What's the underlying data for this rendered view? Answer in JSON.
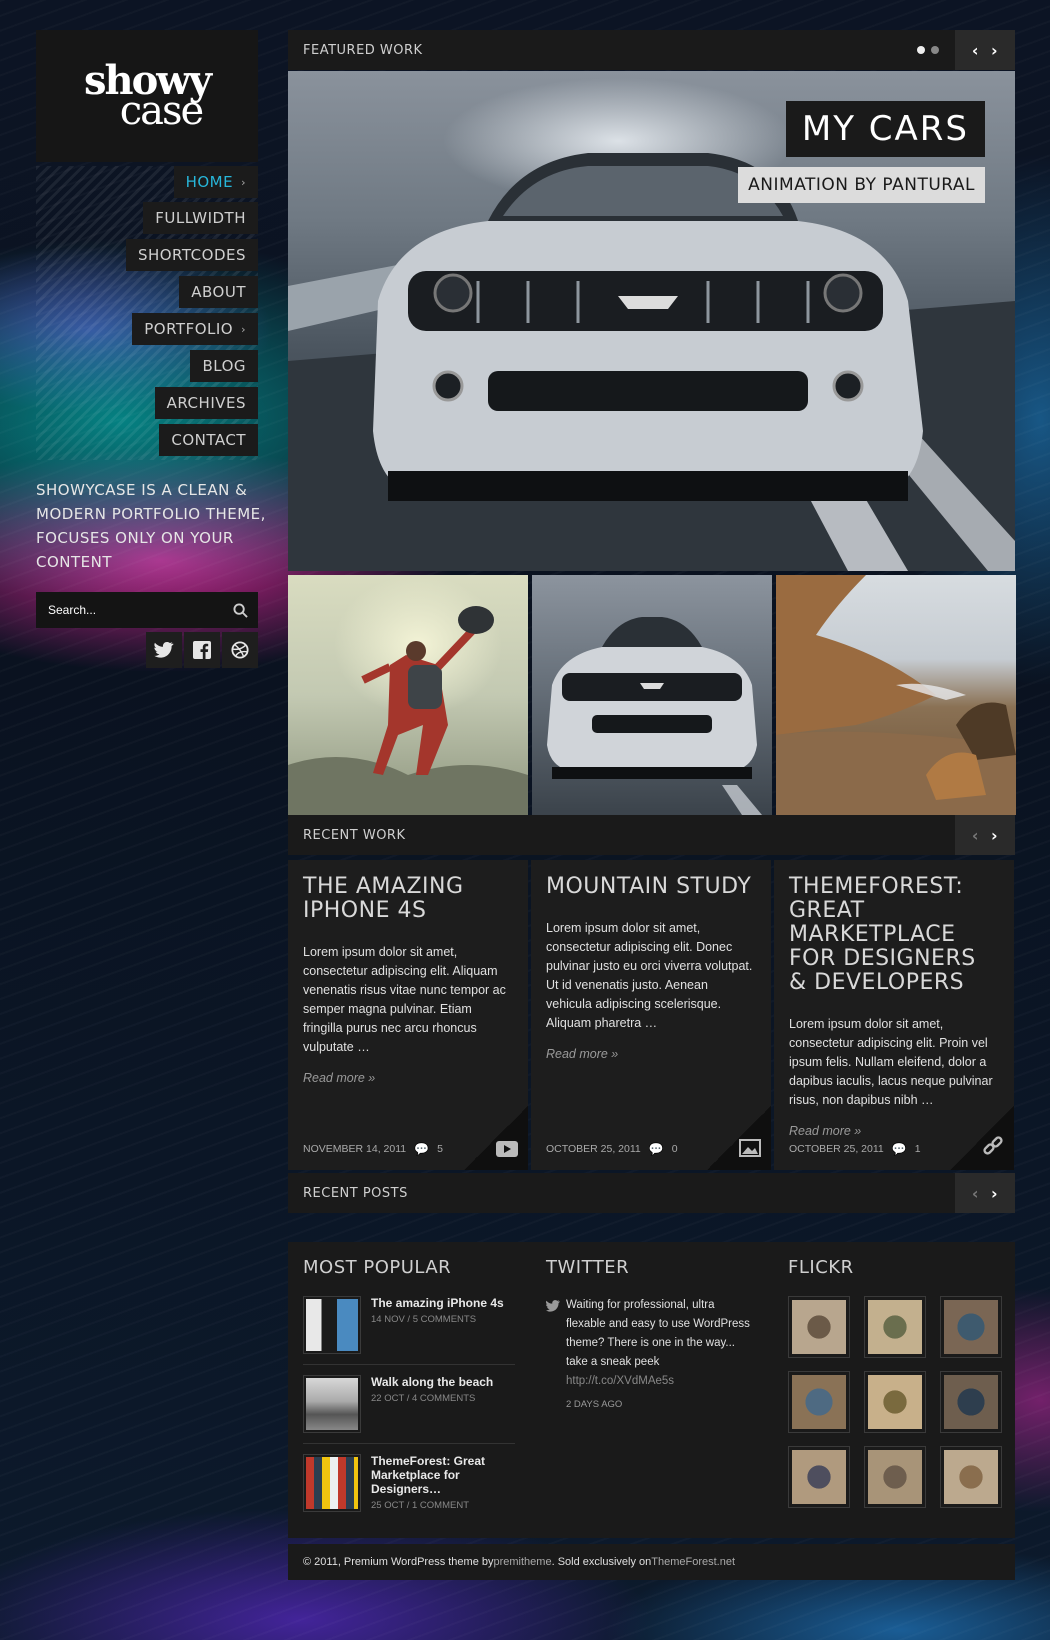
{
  "site": {
    "logo_line1": "showy",
    "logo_line2": "case",
    "tagline": "SHOWYCASE IS A CLEAN & MODERN PORTFOLIO THEME, FOCUSES ONLY ON YOUR CONTENT"
  },
  "nav": {
    "items": [
      {
        "label": "HOME",
        "active": true,
        "has_sub": true
      },
      {
        "label": "FULLWIDTH"
      },
      {
        "label": "SHORTCODES"
      },
      {
        "label": "ABOUT"
      },
      {
        "label": "PORTFOLIO",
        "has_sub": true
      },
      {
        "label": "BLOG"
      },
      {
        "label": "ARCHIVES"
      },
      {
        "label": "CONTACT"
      }
    ]
  },
  "search": {
    "placeholder": "Search..."
  },
  "social": {
    "icons": [
      "twitter-icon",
      "facebook-icon",
      "dribbble-icon"
    ]
  },
  "featured": {
    "label": "FEATURED WORK",
    "slide_title": "MY CARS",
    "slide_subtitle": "ANIMATION BY PANTURAL",
    "dots": 2,
    "active_dot": 1
  },
  "recent_work": {
    "label": "RECENT WORK",
    "items": [
      {
        "title": "THE AMAZING IPHONE 4S",
        "excerpt": "Lorem ipsum dolor sit amet, consectetur adipiscing elit. Aliquam venenatis risus vitae nunc tempor ac semper magna pulvinar. Etiam fringilla purus nec arcu rhoncus vulputate …",
        "read_more": "Read more »",
        "date": "NOVEMBER 14, 2011",
        "comments": "5",
        "icon": "video-icon"
      },
      {
        "title": "MOUNTAIN STUDY",
        "excerpt": "Lorem ipsum dolor sit amet, consectetur adipiscing elit. Donec pulvinar justo eu orci viverra volutpat. Ut id venenatis justo. Aenean vehicula adipiscing scelerisque. Aliquam pharetra …",
        "read_more": "Read more »",
        "date": "OCTOBER 25, 2011",
        "comments": "0",
        "icon": "image-icon"
      },
      {
        "title": "THEMEFOREST: GREAT MARKETPLACE FOR DESIGNERS & DEVELOPERS",
        "excerpt": "Lorem ipsum dolor sit amet, consectetur adipiscing elit. Proin vel ipsum felis. Nullam eleifend, dolor a dapibus iaculis, lacus neque pulvinar risus, non dapibus nibh …",
        "read_more": "Read more »",
        "date": "OCTOBER 25, 2011",
        "comments": "1",
        "icon": "link-icon"
      }
    ]
  },
  "recent_posts": {
    "label": "RECENT POSTS"
  },
  "widgets": {
    "popular": {
      "title": "MOST POPULAR",
      "items": [
        {
          "title": "The amazing iPhone 4s",
          "meta": "14 NOV / 5 COMMENTS"
        },
        {
          "title": "Walk along the beach",
          "meta": "22 OCT / 4 COMMENTS"
        },
        {
          "title": "ThemeForest: Great Marketplace for Designers…",
          "meta": "25 OCT / 1 COMMENT"
        }
      ]
    },
    "twitter": {
      "title": "TWITTER",
      "tweet": "Waiting for professional, ultra flexable and easy to use WordPress theme? There is one in the way... take a sneak peek",
      "link": "http://t.co/XVdMAe5s",
      "time": "2 DAYS AGO"
    },
    "flickr": {
      "title": "FLICKR"
    }
  },
  "footer": {
    "prefix": "© 2011, Premium WordPress theme by ",
    "author": "premitheme",
    "middle": ". Sold exclusively on ",
    "market": "ThemeForest.net"
  },
  "colors": {
    "accent": "#27b6d9",
    "panel": "#1a1a1a"
  }
}
